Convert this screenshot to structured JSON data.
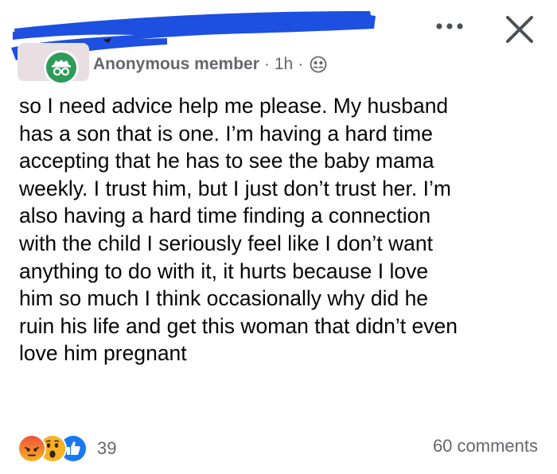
{
  "header": {
    "author": "Anonymous member",
    "separator": "·",
    "time": "1h",
    "privacy": "friends-icon",
    "more_label": "more-options-icon",
    "close_label": "close-icon"
  },
  "post": {
    "lines": [
      "so I need advice help me please. My husband",
      "has a son that is one. I’m having a hard time",
      "accepting that he has to see the baby mama",
      "weekly. I trust him, but I just don’t trust her. I’m",
      "also having a hard time finding a connection",
      "with the child I seriously feel like I don’t want",
      "anything to do with it, it hurts because I love",
      "him so much I think occasionally why did he",
      "ruin his life and get this woman that didn’t even",
      "love him pregnant"
    ]
  },
  "footer": {
    "reactions": [
      "angry-icon",
      "wow-icon",
      "like-icon"
    ],
    "reaction_count": "39",
    "comments": "60 comments"
  },
  "colors": {
    "redaction": "#1d4fe0",
    "anon_green": "#2e9c58",
    "meta_gray": "#65676b",
    "like_blue": "#1877f2",
    "angry_orange": "#e9710f",
    "wow_yellow": "#f7b125"
  }
}
